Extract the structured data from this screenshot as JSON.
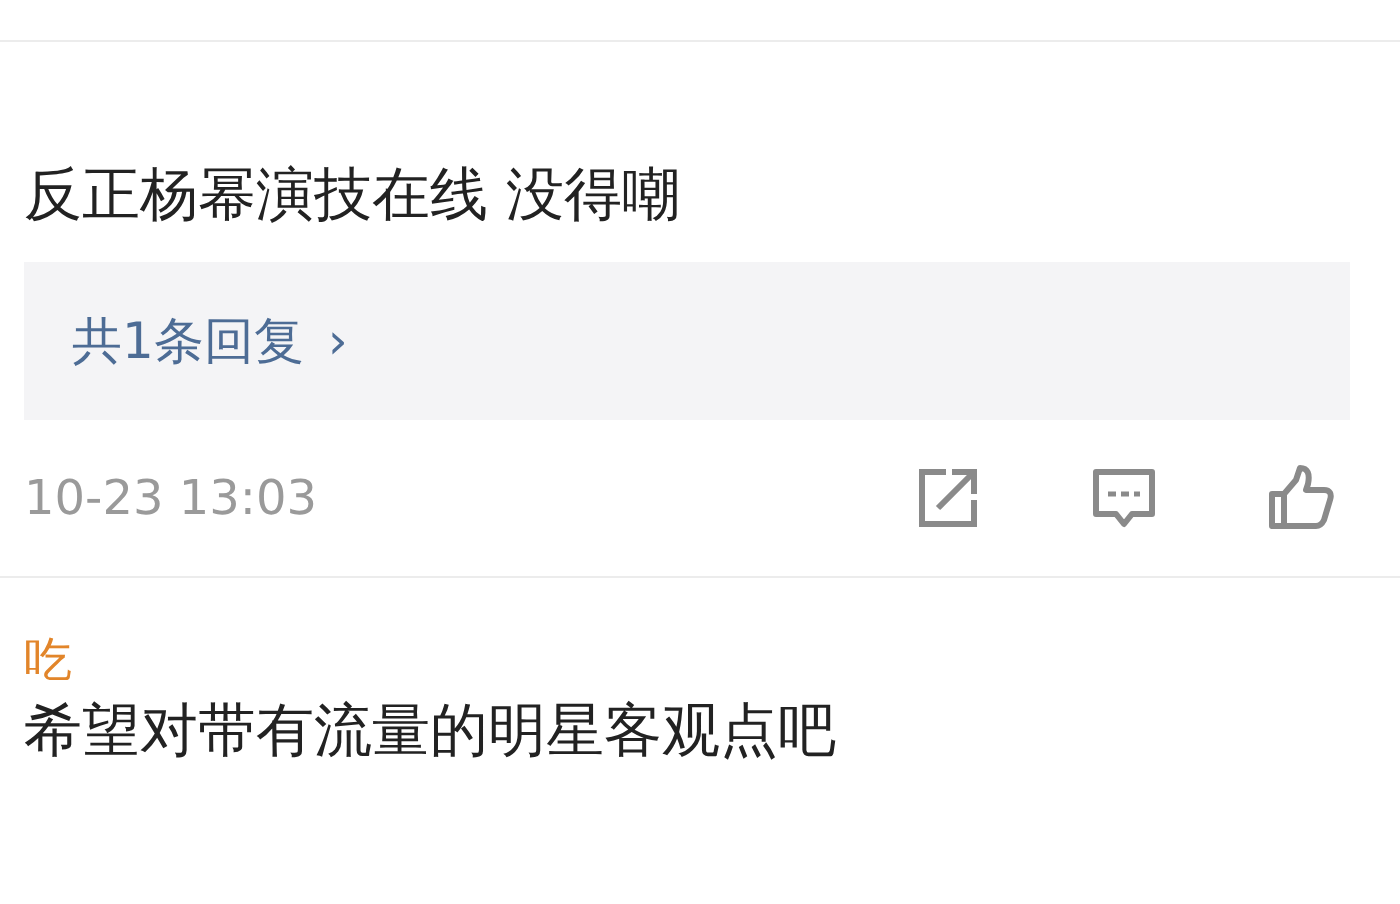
{
  "comments": [
    {
      "text": "反正杨幂演技在线 没得嘲",
      "replies": {
        "label": "共1条回复",
        "chevron": "›"
      },
      "time": "10-23 13:03",
      "liked": false
    },
    {
      "username": "吃",
      "text": "希望对带有流量的明星客观点吧"
    }
  ]
}
